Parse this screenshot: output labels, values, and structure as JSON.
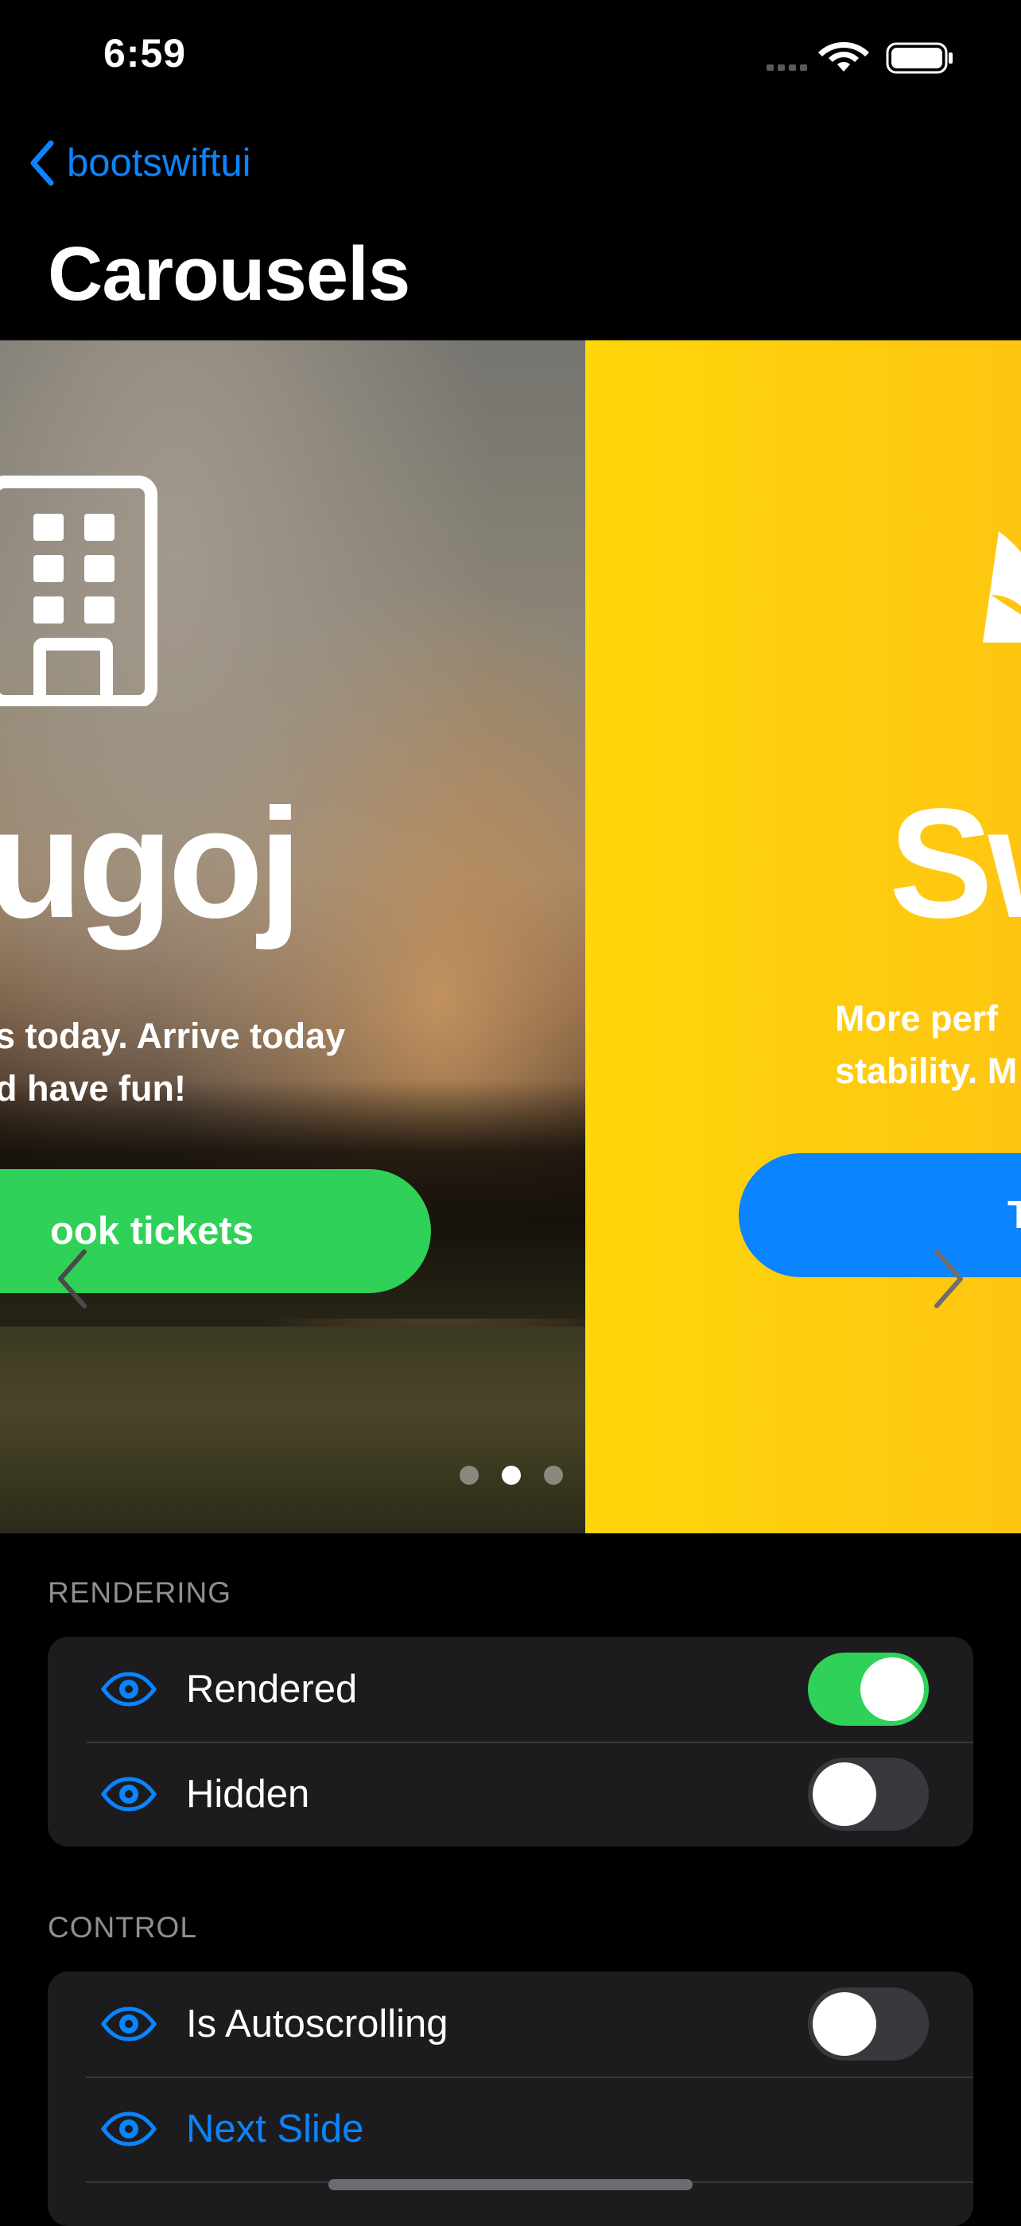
{
  "status_bar": {
    "time": "6:59"
  },
  "nav": {
    "back_label": "bootswiftui",
    "title": "Carousels"
  },
  "carousel": {
    "current_slide": {
      "title": "ugoj",
      "body": "s today. Arrive today\nd have fun!",
      "button": "ook tickets"
    },
    "next_slide": {
      "title": "Sw",
      "body": "More perf\nstability. M",
      "button": "T",
      "background": "#ffd60a"
    },
    "page_count": 3,
    "active_page": 2
  },
  "sections": {
    "rendering": {
      "header": "RENDERING",
      "rows": [
        {
          "label": "Rendered",
          "toggle": true
        },
        {
          "label": "Hidden",
          "toggle": false
        }
      ]
    },
    "control": {
      "header": "CONTROL",
      "rows": [
        {
          "label": "Is Autoscrolling",
          "toggle": false
        },
        {
          "label": "Next Slide"
        }
      ]
    }
  },
  "colors": {
    "accent": "#0a84ff",
    "toggle_on": "#30d158",
    "book_button": "#30d158",
    "slide_yellow": "#ffd60a"
  }
}
